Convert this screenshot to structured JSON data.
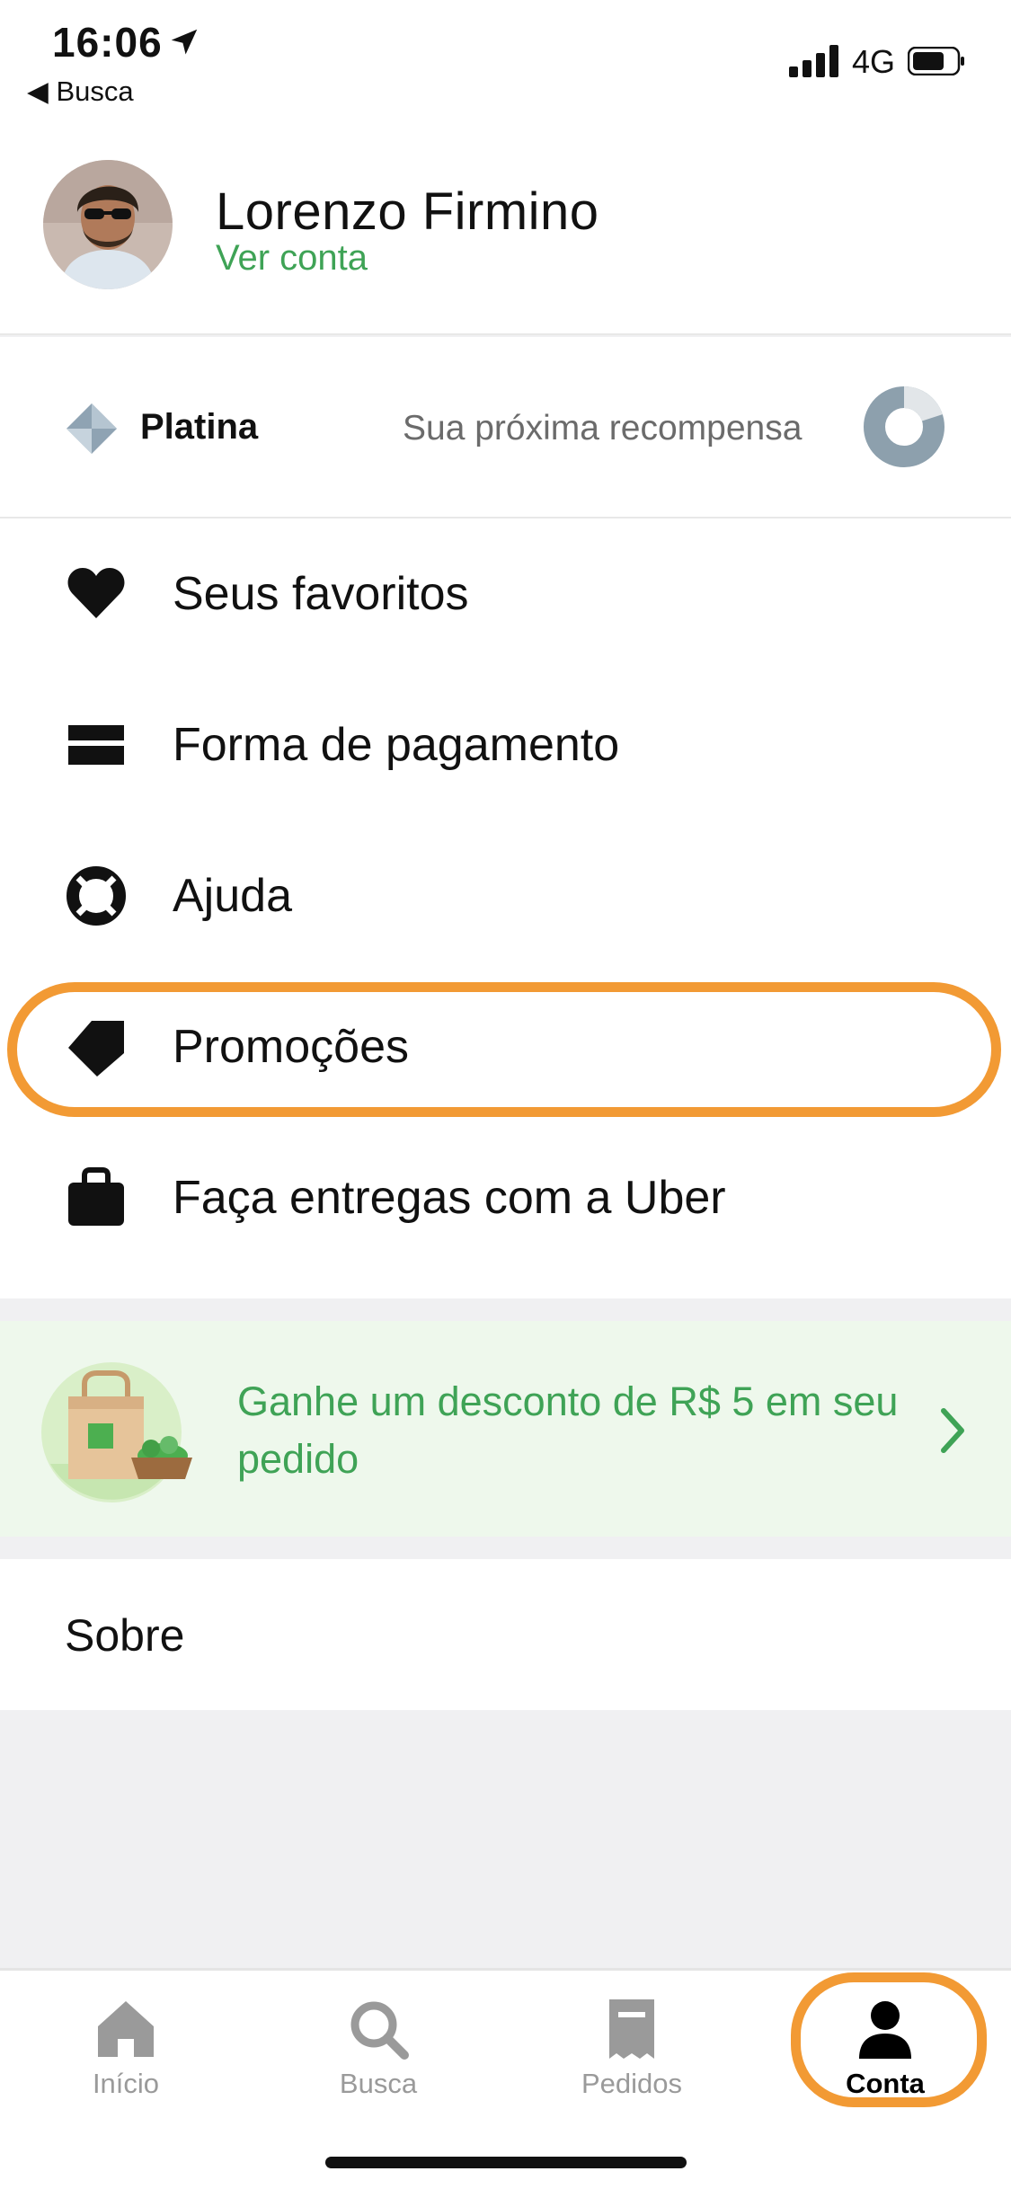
{
  "status_bar": {
    "time": "16:06",
    "back_label": "Busca",
    "network": "4G"
  },
  "profile": {
    "name": "Lorenzo Firmino",
    "link": "Ver conta"
  },
  "rewards": {
    "tier": "Platina",
    "next_reward": "Sua próxima recompensa",
    "progress": 0.2
  },
  "menu": {
    "items": [
      {
        "label": "Seus favoritos",
        "icon": "heart-icon"
      },
      {
        "label": "Forma de pagamento",
        "icon": "credit-card-icon"
      },
      {
        "label": "Ajuda",
        "icon": "lifebuoy-icon"
      },
      {
        "label": "Promoções",
        "icon": "tag-icon"
      },
      {
        "label": "Faça entregas com a Uber",
        "icon": "delivery-bag-icon"
      }
    ]
  },
  "promo": {
    "text": "Ganhe um desconto de R$ 5 em seu pedido"
  },
  "about": {
    "label": "Sobre"
  },
  "tabbar": {
    "tabs": [
      {
        "label": "Início",
        "icon": "home-icon"
      },
      {
        "label": "Busca",
        "icon": "search-icon"
      },
      {
        "label": "Pedidos",
        "icon": "receipt-icon"
      },
      {
        "label": "Conta",
        "icon": "person-icon"
      }
    ],
    "active": "Conta"
  },
  "colors": {
    "accent_green": "#3fa356",
    "highlight_orange": "#f29a34",
    "promo_bg": "#eef8ec"
  }
}
